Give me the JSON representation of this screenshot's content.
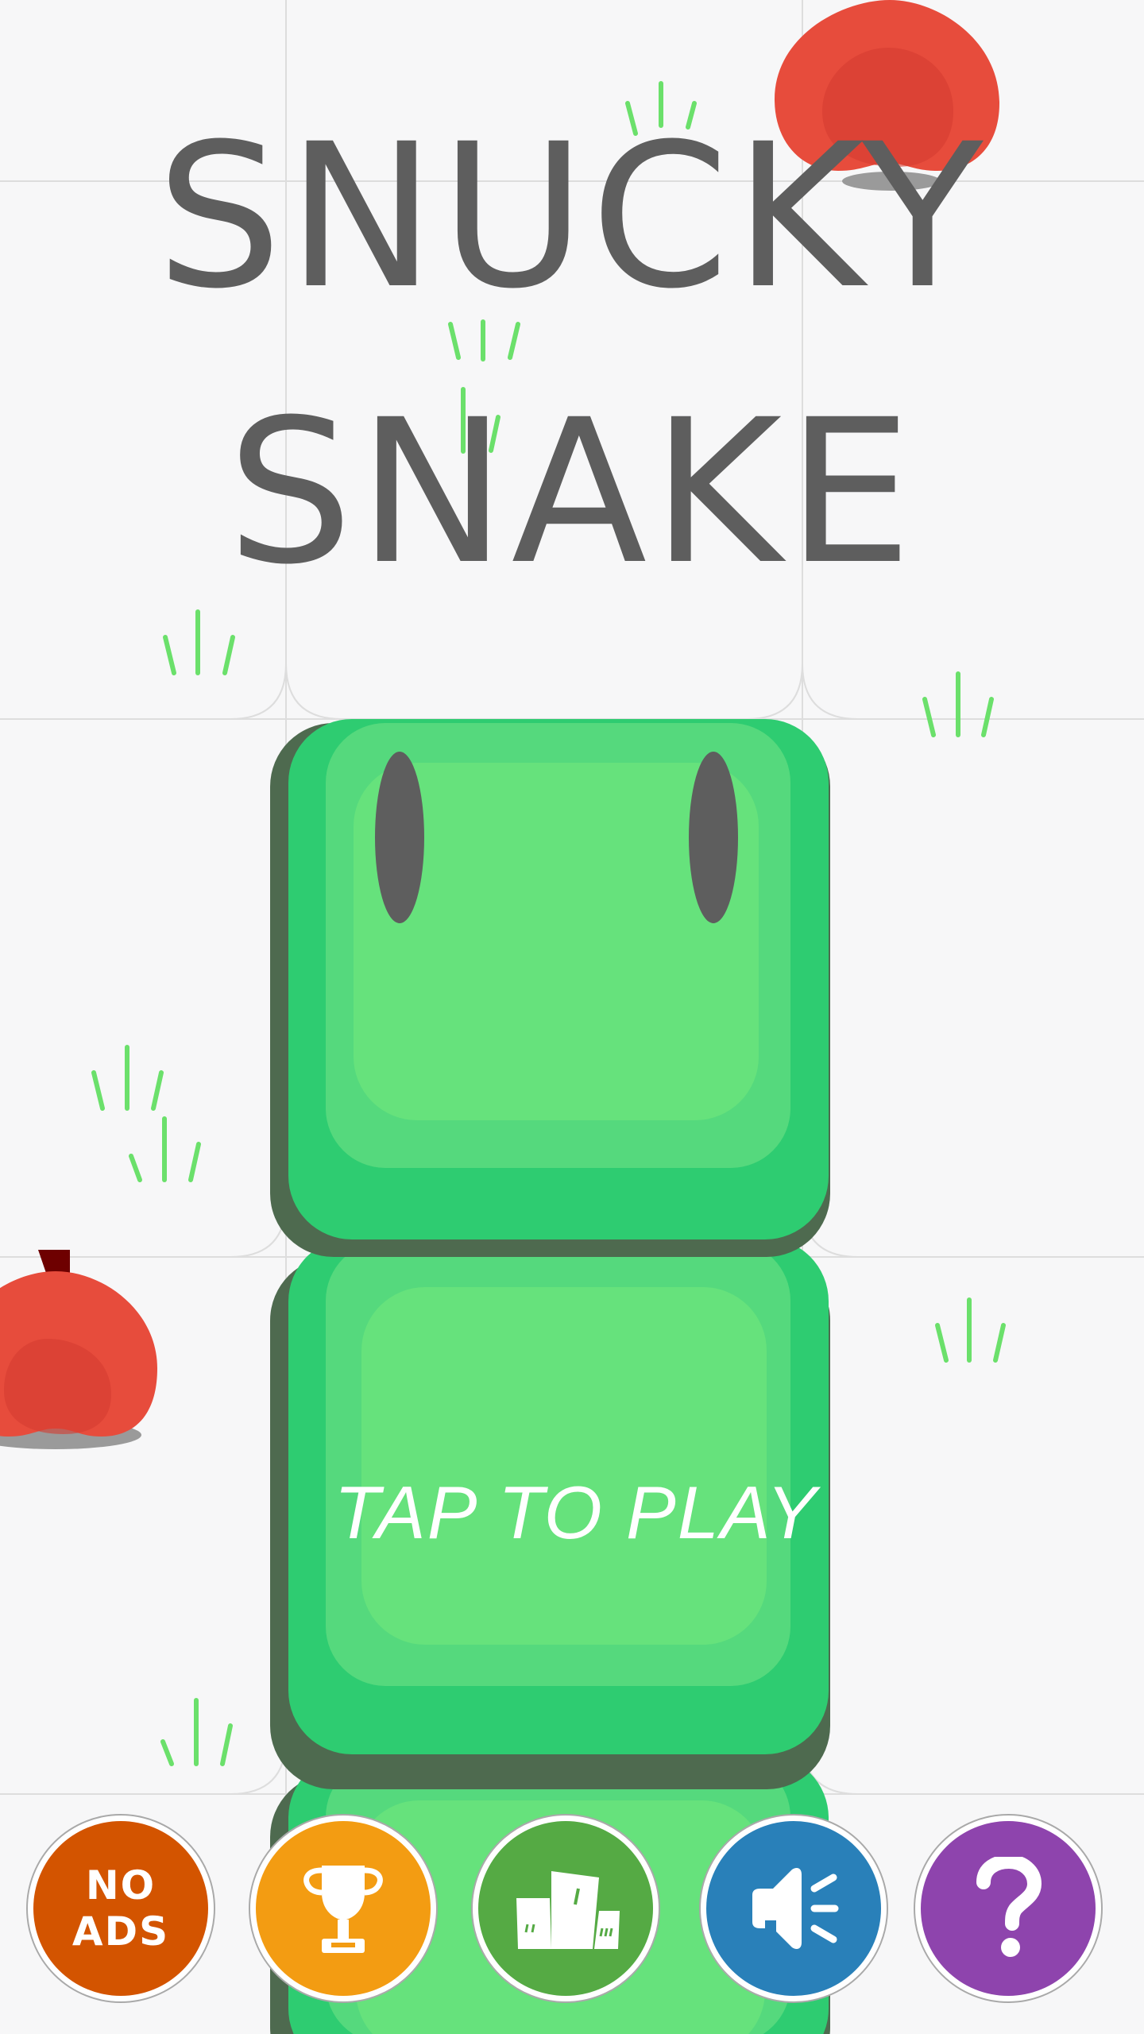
{
  "title": {
    "line1": "SNUCKY",
    "line2": "SNAKE"
  },
  "tap_to_play": "TAP TO PLAY",
  "menu": {
    "no_ads": {
      "line1": "NO",
      "line2": "ADS",
      "color": "#d35400"
    },
    "trophy": {
      "icon": "trophy-icon",
      "color": "#f39c12"
    },
    "leaderboard": {
      "icon": "podium-icon",
      "color": "#55aa44"
    },
    "sound": {
      "icon": "speaker-icon",
      "color": "#2980b9"
    },
    "help": {
      "icon": "question-icon",
      "color": "#8e44ad"
    }
  },
  "colors": {
    "background": "#f7f7f8",
    "snake_dark": "#2ecc71",
    "snake_mid": "#55d97d",
    "snake_light": "#66e27c",
    "apple": "#e74c3c",
    "grass": "#6be06b",
    "title": "#5e5e5e"
  }
}
